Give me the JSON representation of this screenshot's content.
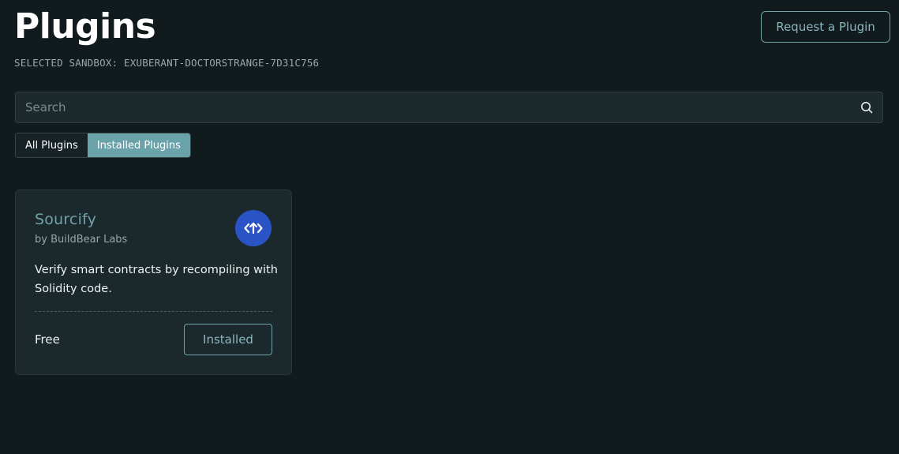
{
  "header": {
    "title": "Plugins",
    "request_button_label": "Request a Plugin",
    "sandbox_label": "SELECTED SANDBOX: EXUBERANT-DOCTORSTRANGE-7D31C756"
  },
  "search": {
    "placeholder": "Search",
    "value": "",
    "icon": "search-icon"
  },
  "tabs": [
    {
      "label": "All Plugins",
      "active": false
    },
    {
      "label": "Installed Plugins",
      "active": true
    }
  ],
  "plugins": [
    {
      "name": "Sourcify",
      "author": "by BuildBear Labs",
      "description": "Verify smart contracts by recompiling with Solidity code.",
      "price": "Free",
      "action_label": "Installed",
      "logo_icon": "sourcify-logo-icon",
      "logo_color": "#2a54c6"
    }
  ],
  "colors": {
    "background": "#111a1d",
    "accent": "#6aa3aa",
    "card_background": "#1b282c"
  }
}
